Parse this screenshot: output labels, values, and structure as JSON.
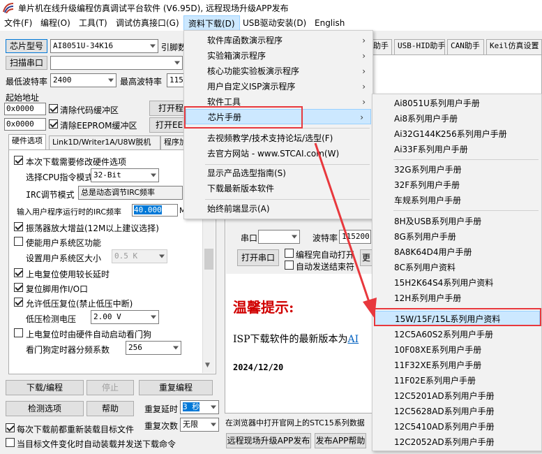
{
  "window": {
    "title": "单片机在线升级编程仿真调试平台软件 (V6.95D), 远程现场升级APP发布"
  },
  "menubar": [
    {
      "label": "文件(F)"
    },
    {
      "label": "编程(O)"
    },
    {
      "label": "工具(T)"
    },
    {
      "label": "调试仿真接口(G)"
    },
    {
      "label": "资料下载(D)"
    },
    {
      "label": "USB驱动安装(D)"
    },
    {
      "label": "English"
    }
  ],
  "left": {
    "chip_button": "芯片型号",
    "chip_value": "AI8051U-34K16",
    "pin_label": "引脚数",
    "scan_button": "扫描串口",
    "min_baud_label": "最低波特率",
    "min_baud_value": "2400",
    "max_baud_label": "最高波特率",
    "max_baud_value": "1152",
    "start_addr_label": "起始地址",
    "addr1": "0x0000",
    "clear_code": "清除代码缓冲区",
    "open1": "打开程",
    "addr2": "0x0000",
    "clear_eeprom": "清除EEPROM缓冲区",
    "open2": "打开EE",
    "tabs": [
      "硬件选项",
      "Link1D/Writer1A/U8W脱机",
      "程序加"
    ],
    "opt_modify_hw": "本次下载需要修改硬件选项",
    "cpu_mode_label": "选择CPU指令模式",
    "cpu_mode_value": "32-Bit",
    "irc_mode_label": "IRC调节模式",
    "irc_mode_value": "总是动态调节IRC频率",
    "irc_freq_label": "输入用户程序运行时的IRC频率",
    "irc_freq_value": "40.000",
    "irc_freq_unit": "M",
    "osc_gain": "振荡器放大增益(12M以上建议选择)",
    "sys_volt_enable": "使能用户系统区功能",
    "sys_volt_label": "设置用户系统区大小",
    "sys_volt_value": "0.5 K",
    "power_on_delay": "上电复位使用较长延时",
    "reset_pin_io": "复位脚用作I/O口",
    "low_volt_reset": "允许低压复位(禁止低压中断)",
    "low_volt_label": "低压检测电压",
    "low_volt_value": "2.00 V",
    "wdt_start": "上电复位时由硬件自动启动看门狗",
    "wdt_div_label": "看门狗定时器分频系数",
    "wdt_div_value": "256",
    "download_btn": "下载/编程",
    "stop_btn": "停止",
    "reprogram_btn": "重复编程",
    "detect_btn": "检测选项",
    "help_btn": "帮助",
    "repeat_delay_label": "重复延时",
    "repeat_delay_value": "3 秒",
    "repeat_count_label": "重复次数",
    "repeat_count_value": "无限",
    "reload_each": "每次下载前都重新装载目标文件",
    "auto_reload": "当目标文件变化时自动装载并发送下载命令"
  },
  "right": {
    "tabs": [
      "助手",
      "USB-HID助手",
      "CAN助手",
      "Keil仿真设置"
    ],
    "serial_label": "串口",
    "baud_label": "波特率",
    "baud_value": "115200",
    "auto_open": "编程完自动打开",
    "auto_send": "自动发送结束符",
    "open_serial_btn": "打开串口",
    "more_btn": "更",
    "notice_title": "温馨提示:",
    "notice_text": "ISP下载软件的最新版本为",
    "notice_link": "AI",
    "notice_date": "2024/12/20",
    "status_text": "在浏览器中打开官网上的STC15系列数据",
    "remote_btn": "远程现场升级APP发布",
    "publish_btn": "发布APP帮助"
  },
  "dropdown": {
    "items": [
      {
        "label": "软件库函数演示程序",
        "submenu": true
      },
      {
        "label": "实验箱演示程序",
        "submenu": true
      },
      {
        "label": "核心功能实验板演示程序",
        "submenu": true
      },
      {
        "label": "用户自定义ISP演示程序",
        "submenu": true
      },
      {
        "label": "软件工具",
        "submenu": true
      },
      {
        "label": "芯片手册",
        "submenu": true,
        "highlighted": true
      },
      {
        "label": "去视频教学/技术支持论坛/选型(F)",
        "submenu": false
      },
      {
        "label": "去官方网站 - www.STCAI.com(W)",
        "submenu": false
      },
      {
        "label": "显示产品选型指南(S)",
        "submenu": false
      },
      {
        "label": "下载最新版本软件",
        "submenu": false
      },
      {
        "label": "始终前端显示(A)",
        "submenu": false
      }
    ]
  },
  "submenu": {
    "items": [
      "Ai8051U系列用户手册",
      "Ai8系列用户手册",
      "Ai32G144K256系列用户手册",
      "Ai33F系列用户手册",
      "32G系列用户手册",
      "32F系列用户手册",
      "车规系列用户手册",
      "8H及USB系列用户手册",
      "8G系列用户手册",
      "8A8K64D4用户手册",
      "8C系列用户资料",
      "15H2K64S4系列用户资料",
      "12H系列用户手册",
      "15W/15F/15L系列用户资料",
      "12C5A60S2系列用户手册",
      "10F08XE系列用户手册",
      "11F32XE系列用户手册",
      "11F02E系列用户手册",
      "12C5201AD系列用户手册",
      "12C5628AD系列用户手册",
      "12C5410AD系列用户手册",
      "12C2052AD系列用户手册"
    ],
    "highlighted_index": 13
  },
  "colors": {
    "menu_highlight": "#cce8ff",
    "annotation_red": "#e8383d",
    "notice_red": "#d00000",
    "link_blue": "#0563c1"
  }
}
